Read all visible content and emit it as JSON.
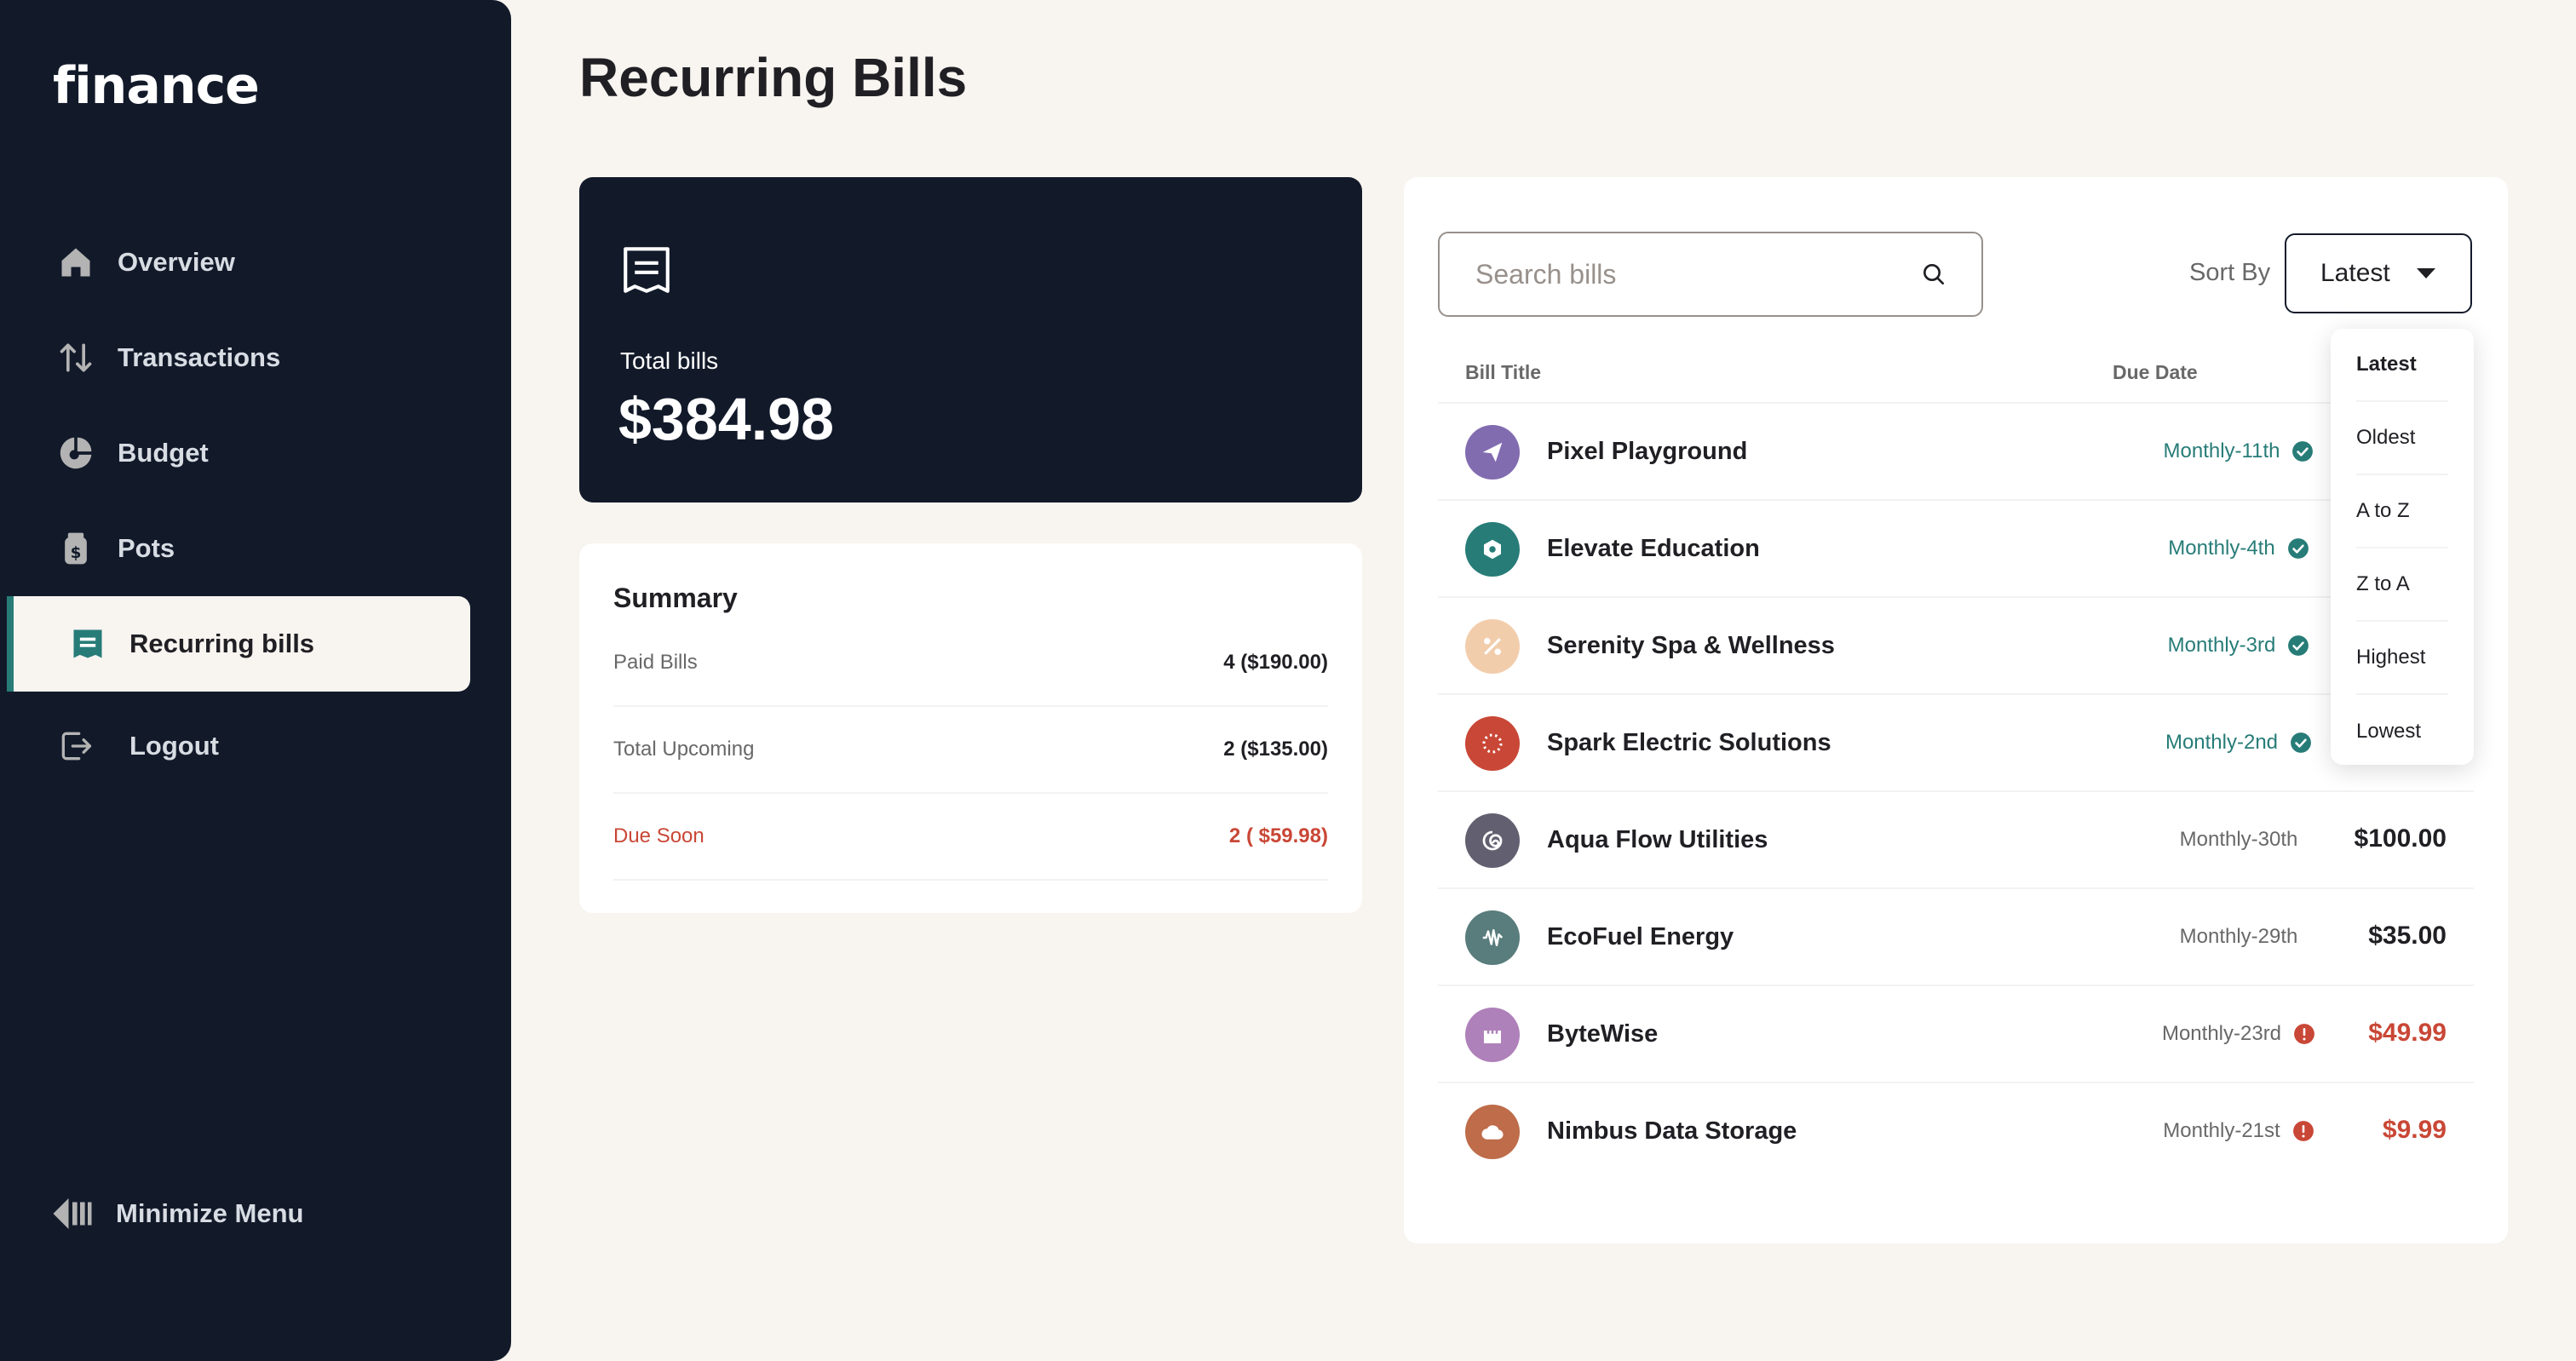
{
  "app": {
    "logo": "finance"
  },
  "sidebar": {
    "items": [
      {
        "label": "Overview",
        "icon": "home-icon"
      },
      {
        "label": "Transactions",
        "icon": "arrows-updown-icon"
      },
      {
        "label": "Budget",
        "icon": "pie-chart-icon"
      },
      {
        "label": "Pots",
        "icon": "jar-icon"
      },
      {
        "label": "Recurring bills",
        "icon": "receipt-icon",
        "active": true
      },
      {
        "label": "Logout",
        "icon": "logout-icon"
      }
    ],
    "minimize_label": "Minimize Menu"
  },
  "page": {
    "title": "Recurring Bills"
  },
  "total_card": {
    "label": "Total bills",
    "amount": "$384.98"
  },
  "summary": {
    "title": "Summary",
    "rows": [
      {
        "label": "Paid Bills",
        "value": "4 ($190.00)"
      },
      {
        "label": "Total Upcoming",
        "value": "2 ($135.00)"
      },
      {
        "label": "Due Soon",
        "value": "2 ( $59.98)"
      }
    ]
  },
  "bills": {
    "search_placeholder": "Search bills",
    "sort_label": "Sort By",
    "sort_selected": "Latest",
    "sort_options": [
      "Latest",
      "Oldest",
      "A to Z",
      "Z to A",
      "Highest",
      "Lowest"
    ],
    "columns": {
      "title": "Bill Title",
      "due": "Due Date"
    },
    "rows": [
      {
        "name": "Pixel Playground",
        "due": "Monthly-11th",
        "status": "paid",
        "amount": "",
        "color": "#826CB0",
        "icon": "paper-plane-icon"
      },
      {
        "name": "Elevate Education",
        "due": "Monthly-4th",
        "status": "paid",
        "amount": "",
        "color": "#277C78",
        "icon": "hexagon-icon"
      },
      {
        "name": "Serenity Spa & Wellness",
        "due": "Monthly-3rd",
        "status": "paid",
        "amount": "",
        "color": "#F2CDAC",
        "icon": "percent-icon"
      },
      {
        "name": "Spark Electric Solutions",
        "due": "Monthly-2nd",
        "status": "paid",
        "amount": "",
        "color": "#C94736",
        "icon": "dotted-circle-icon"
      },
      {
        "name": "Aqua Flow Utilities",
        "due": "Monthly-30th",
        "status": "upcoming",
        "amount": "$100.00",
        "color": "#626070",
        "icon": "spiral-icon"
      },
      {
        "name": "EcoFuel Energy",
        "due": "Monthly-29th",
        "status": "upcoming",
        "amount": "$35.00",
        "color": "#597C7C",
        "icon": "waveform-icon"
      },
      {
        "name": "ByteWise",
        "due": "Monthly-23rd",
        "status": "overdue",
        "amount": "$49.99",
        "color": "#AF81BA",
        "icon": "castle-icon"
      },
      {
        "name": "Nimbus Data Storage",
        "due": "Monthly-21st",
        "status": "overdue",
        "amount": "$9.99",
        "color": "#BE6C49",
        "icon": "cloud-icon"
      }
    ]
  },
  "colors": {
    "sidebar_bg": "#121A2A",
    "page_bg": "#F8F4F0",
    "accent_green": "#277C78",
    "alert_red": "#C94736",
    "muted_text": "#696868"
  }
}
